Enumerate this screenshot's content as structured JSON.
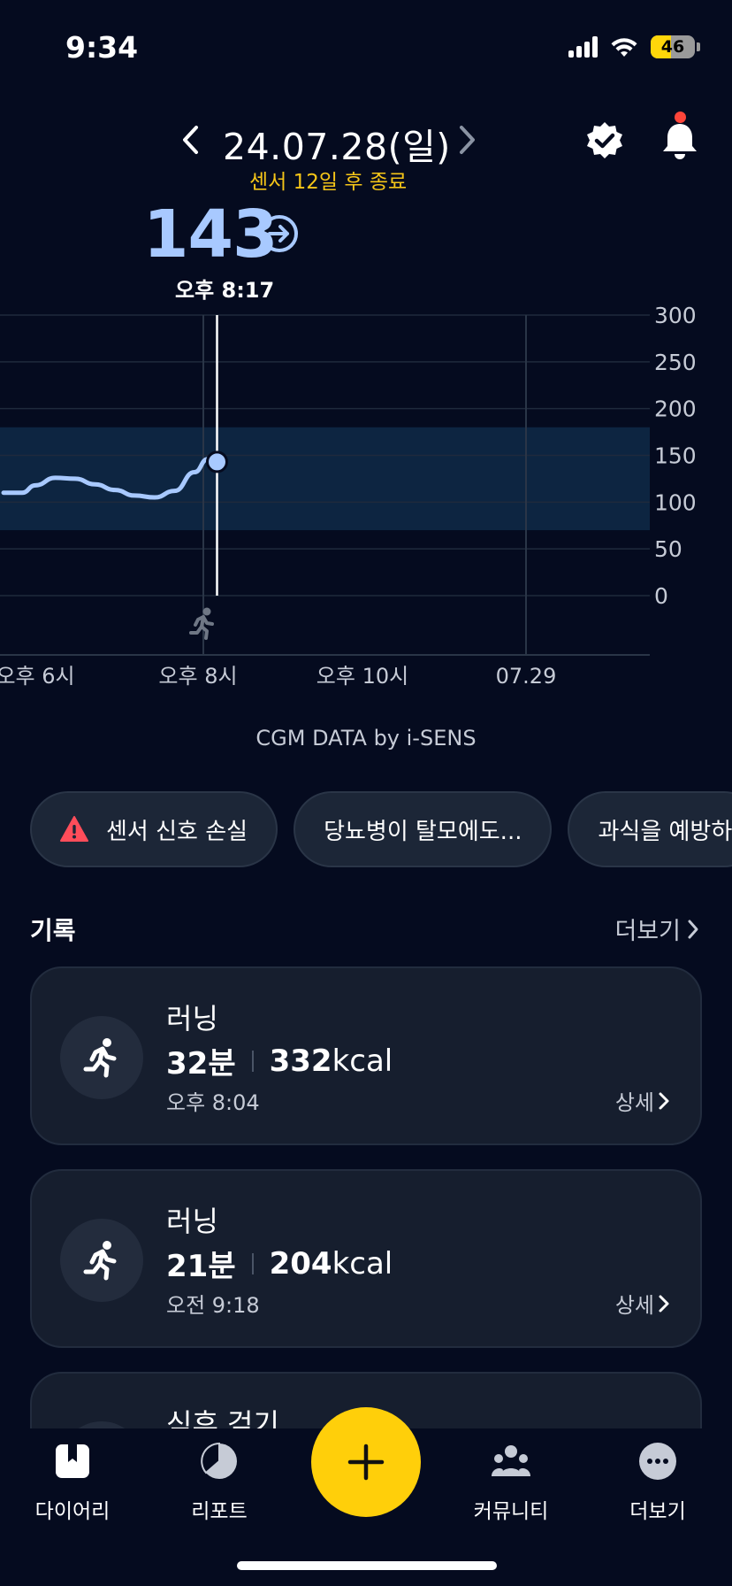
{
  "status_bar": {
    "time": "9:34",
    "battery": "46",
    "battery_fraction": 0.46
  },
  "header": {
    "date": "24.07.28(일)",
    "sensor_notice": "센서 12일 후 종료",
    "glucose_value": "143",
    "reading_time": "오후 8:17"
  },
  "chart_data": {
    "type": "line",
    "y_ticks": [
      "300",
      "250",
      "200",
      "150",
      "100",
      "50",
      "0"
    ],
    "ylim": [
      0,
      300
    ],
    "target_range": [
      70,
      180
    ],
    "x_ticks": [
      "오후 6시",
      "오후 8시",
      "오후 10시",
      "07.29"
    ],
    "series": [
      {
        "x": [
          "17:36",
          "17:50",
          "18:00",
          "18:15",
          "18:30",
          "18:45",
          "19:00",
          "19:15",
          "19:30",
          "19:45",
          "20:00",
          "20:10",
          "20:17"
        ],
        "values": [
          110,
          110,
          118,
          126,
          125,
          119,
          113,
          107,
          105,
          112,
          132,
          146,
          143
        ]
      }
    ],
    "selected_point": {
      "x": "20:17",
      "value": 143
    },
    "event_marker": "running"
  },
  "chart_credit": "CGM DATA by i-SENS",
  "chips": [
    {
      "label": "센서 신호 손실",
      "icon": "warning-icon"
    },
    {
      "label": "당뇨병이 탈모에도..."
    },
    {
      "label": "과식을 예방하"
    }
  ],
  "records": {
    "title": "기록",
    "more_label": "더보기",
    "items": [
      {
        "name": "러닝",
        "duration": "32분",
        "kcal": "332",
        "unit": "kcal",
        "time": "오후 8:04",
        "detail": "상세"
      },
      {
        "name": "러닝",
        "duration": "21분",
        "kcal": "204",
        "unit": "kcal",
        "time": "오전 9:18",
        "detail": "상세"
      },
      {
        "name": "식후 걷기"
      }
    ]
  },
  "tabbar": {
    "diary": "다이어리",
    "report": "리포트",
    "community": "커뮤니티",
    "more": "더보기"
  },
  "colors": {
    "accent": "#ffcf0a",
    "glucose": "#a8c9ff",
    "background": "#050b1f",
    "warning": "#f5c518"
  }
}
